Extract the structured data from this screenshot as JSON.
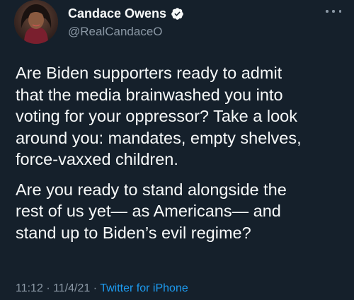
{
  "tweet": {
    "author": {
      "name": "Candace Owens",
      "handle": "@RealCandaceO",
      "verified": true
    },
    "paragraphs": [
      "Are Biden supporters ready to admit\nthat the media brainwashed you into\nvoting for your oppressor? Take a look\naround you: mandates, empty shelves,\nforce-vaxxed children.",
      "Are you ready to stand alongside the\nrest of us yet— as Americans— and\nstand up to Biden’s evil regime?"
    ],
    "meta": {
      "time": "11:12",
      "separator": "·",
      "date": "11/4/21",
      "source": "Twitter for iPhone"
    }
  },
  "icons": {
    "verified": "verified-badge-icon",
    "more": "more-horizontal-icon"
  },
  "colors": {
    "background": "#15202b",
    "text": "#f7f9f9",
    "secondary": "#8b98a5",
    "accent": "#1d9bf0"
  }
}
